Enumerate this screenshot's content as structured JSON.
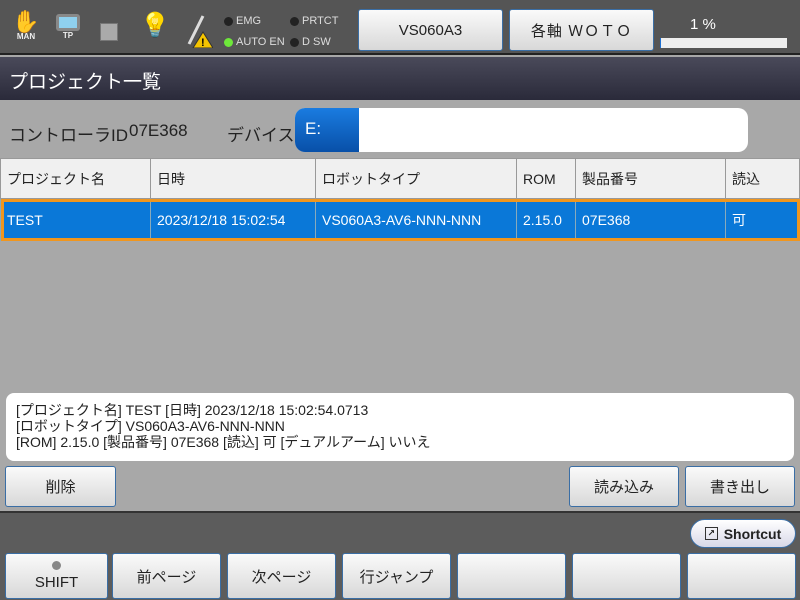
{
  "status_bar": {
    "mode_label": "MAN",
    "tp_label": "TP",
    "indicators": [
      {
        "label": "EMG",
        "on": false
      },
      {
        "label": "PRTCT",
        "on": false
      },
      {
        "label": "AUTO EN",
        "on": true
      },
      {
        "label": "D SW",
        "on": false
      }
    ],
    "robot_button": "VS060A3",
    "axis_button": "各軸 ＷＯＴＯ",
    "speed_text": "1 %",
    "speed_percent": 1,
    "led_on_color": "#6ee83a"
  },
  "title": "プロジェクト一覧",
  "controller": {
    "id_label": "コントローラID",
    "id_value": "07E368",
    "device_label": "デバイス",
    "device_value": "E:"
  },
  "table": {
    "headers": [
      "プロジェクト名",
      "日時",
      "ロボットタイプ",
      "ROM",
      "製品番号",
      "読込"
    ],
    "rows": [
      [
        "TEST",
        "2023/12/18 15:02:54",
        "VS060A3-AV6-NNN-NNN",
        "2.15.0",
        "07E368",
        "可"
      ]
    ],
    "selected_color": "#0a78d8",
    "selected_border": "#f0961e"
  },
  "info": {
    "line1": "[プロジェクト名] TEST [日時] 2023/12/18 15:02:54.0713",
    "line2": "[ロボットタイプ] VS060A3-AV6-NNN-NNN",
    "line3": "[ROM] 2.15.0 [製品番号] 07E368 [読込] 可 [デュアルアーム] いいえ"
  },
  "actions": {
    "delete": "削除",
    "load": "読み込み",
    "export": "書き出し"
  },
  "shortcut": "Shortcut",
  "function_keys": [
    "SHIFT",
    "前ページ",
    "次ページ",
    "行ジャンプ",
    "",
    "",
    ""
  ]
}
